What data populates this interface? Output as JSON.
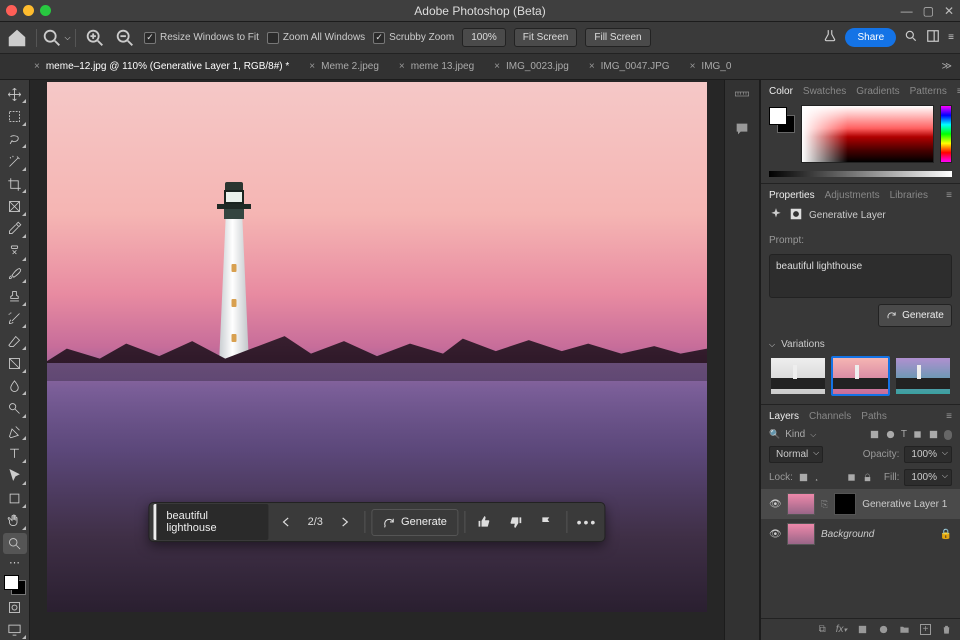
{
  "app_title": "Adobe Photoshop (Beta)",
  "optbar": {
    "resize_fit": "Resize Windows to Fit",
    "zoom_all": "Zoom All Windows",
    "scrubby": "Scrubby Zoom",
    "zoom_pct": "100%",
    "fit_screen": "Fit Screen",
    "fill_screen": "Fill Screen",
    "share": "Share"
  },
  "tabs": [
    {
      "label": "meme–12.jpg @ 110% (Generative Layer 1, RGB/8#) *",
      "active": true
    },
    {
      "label": "Meme 2.jpeg",
      "active": false
    },
    {
      "label": "meme 13.jpeg",
      "active": false
    },
    {
      "label": "IMG_0023.jpg",
      "active": false
    },
    {
      "label": "IMG_0047.JPG",
      "active": false
    },
    {
      "label": "IMG_0",
      "active": false
    }
  ],
  "floatbar": {
    "prompt": "beautiful lighthouse",
    "counter": "2/3",
    "generate": "Generate"
  },
  "color_panel": {
    "tabs": [
      "Color",
      "Swatches",
      "Gradients",
      "Patterns"
    ],
    "active": 0
  },
  "props_panel": {
    "tabs": [
      "Properties",
      "Adjustments",
      "Libraries"
    ],
    "active": 0,
    "type_label": "Generative Layer",
    "prompt_label": "Prompt:",
    "prompt_text": "beautiful lighthouse",
    "generate": "Generate",
    "variations_label": "Variations"
  },
  "layers_panel": {
    "tabs": [
      "Layers",
      "Channels",
      "Paths"
    ],
    "active": 0,
    "kind": "Kind",
    "blend": "Normal",
    "opacity_label": "Opacity:",
    "opacity": "100%",
    "lock_label": "Lock:",
    "fill_label": "Fill:",
    "fill": "100%",
    "layers": [
      {
        "name": "Generative Layer 1",
        "bg": false,
        "selected": true,
        "mask": true
      },
      {
        "name": "Background",
        "bg": true,
        "selected": false,
        "mask": false
      }
    ]
  }
}
